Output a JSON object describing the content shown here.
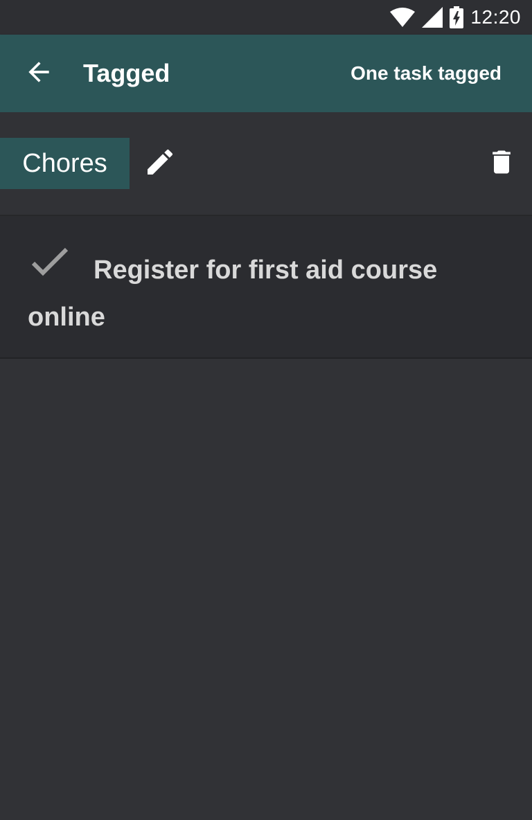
{
  "status_bar": {
    "time": "12:20",
    "icons": [
      "wifi-icon",
      "signal-icon",
      "battery-charging-icon"
    ]
  },
  "app_bar": {
    "back_icon": "arrow-back-icon",
    "title": "Tagged",
    "subtitle": "One task tagged"
  },
  "tag": {
    "name": "Chores",
    "edit_icon": "pencil-icon",
    "delete_icon": "trash-icon"
  },
  "tasks": [
    {
      "title": "Register for first aid course online",
      "completed": true,
      "status_icon": "checkmark-icon"
    }
  ],
  "colors": {
    "background": "#313236",
    "status_bar": "#2e2f33",
    "accent": "#2c5658",
    "task_card": "#2b2c30",
    "task_text": "#d9d9d9",
    "checkmark": "#9e9e9e"
  }
}
